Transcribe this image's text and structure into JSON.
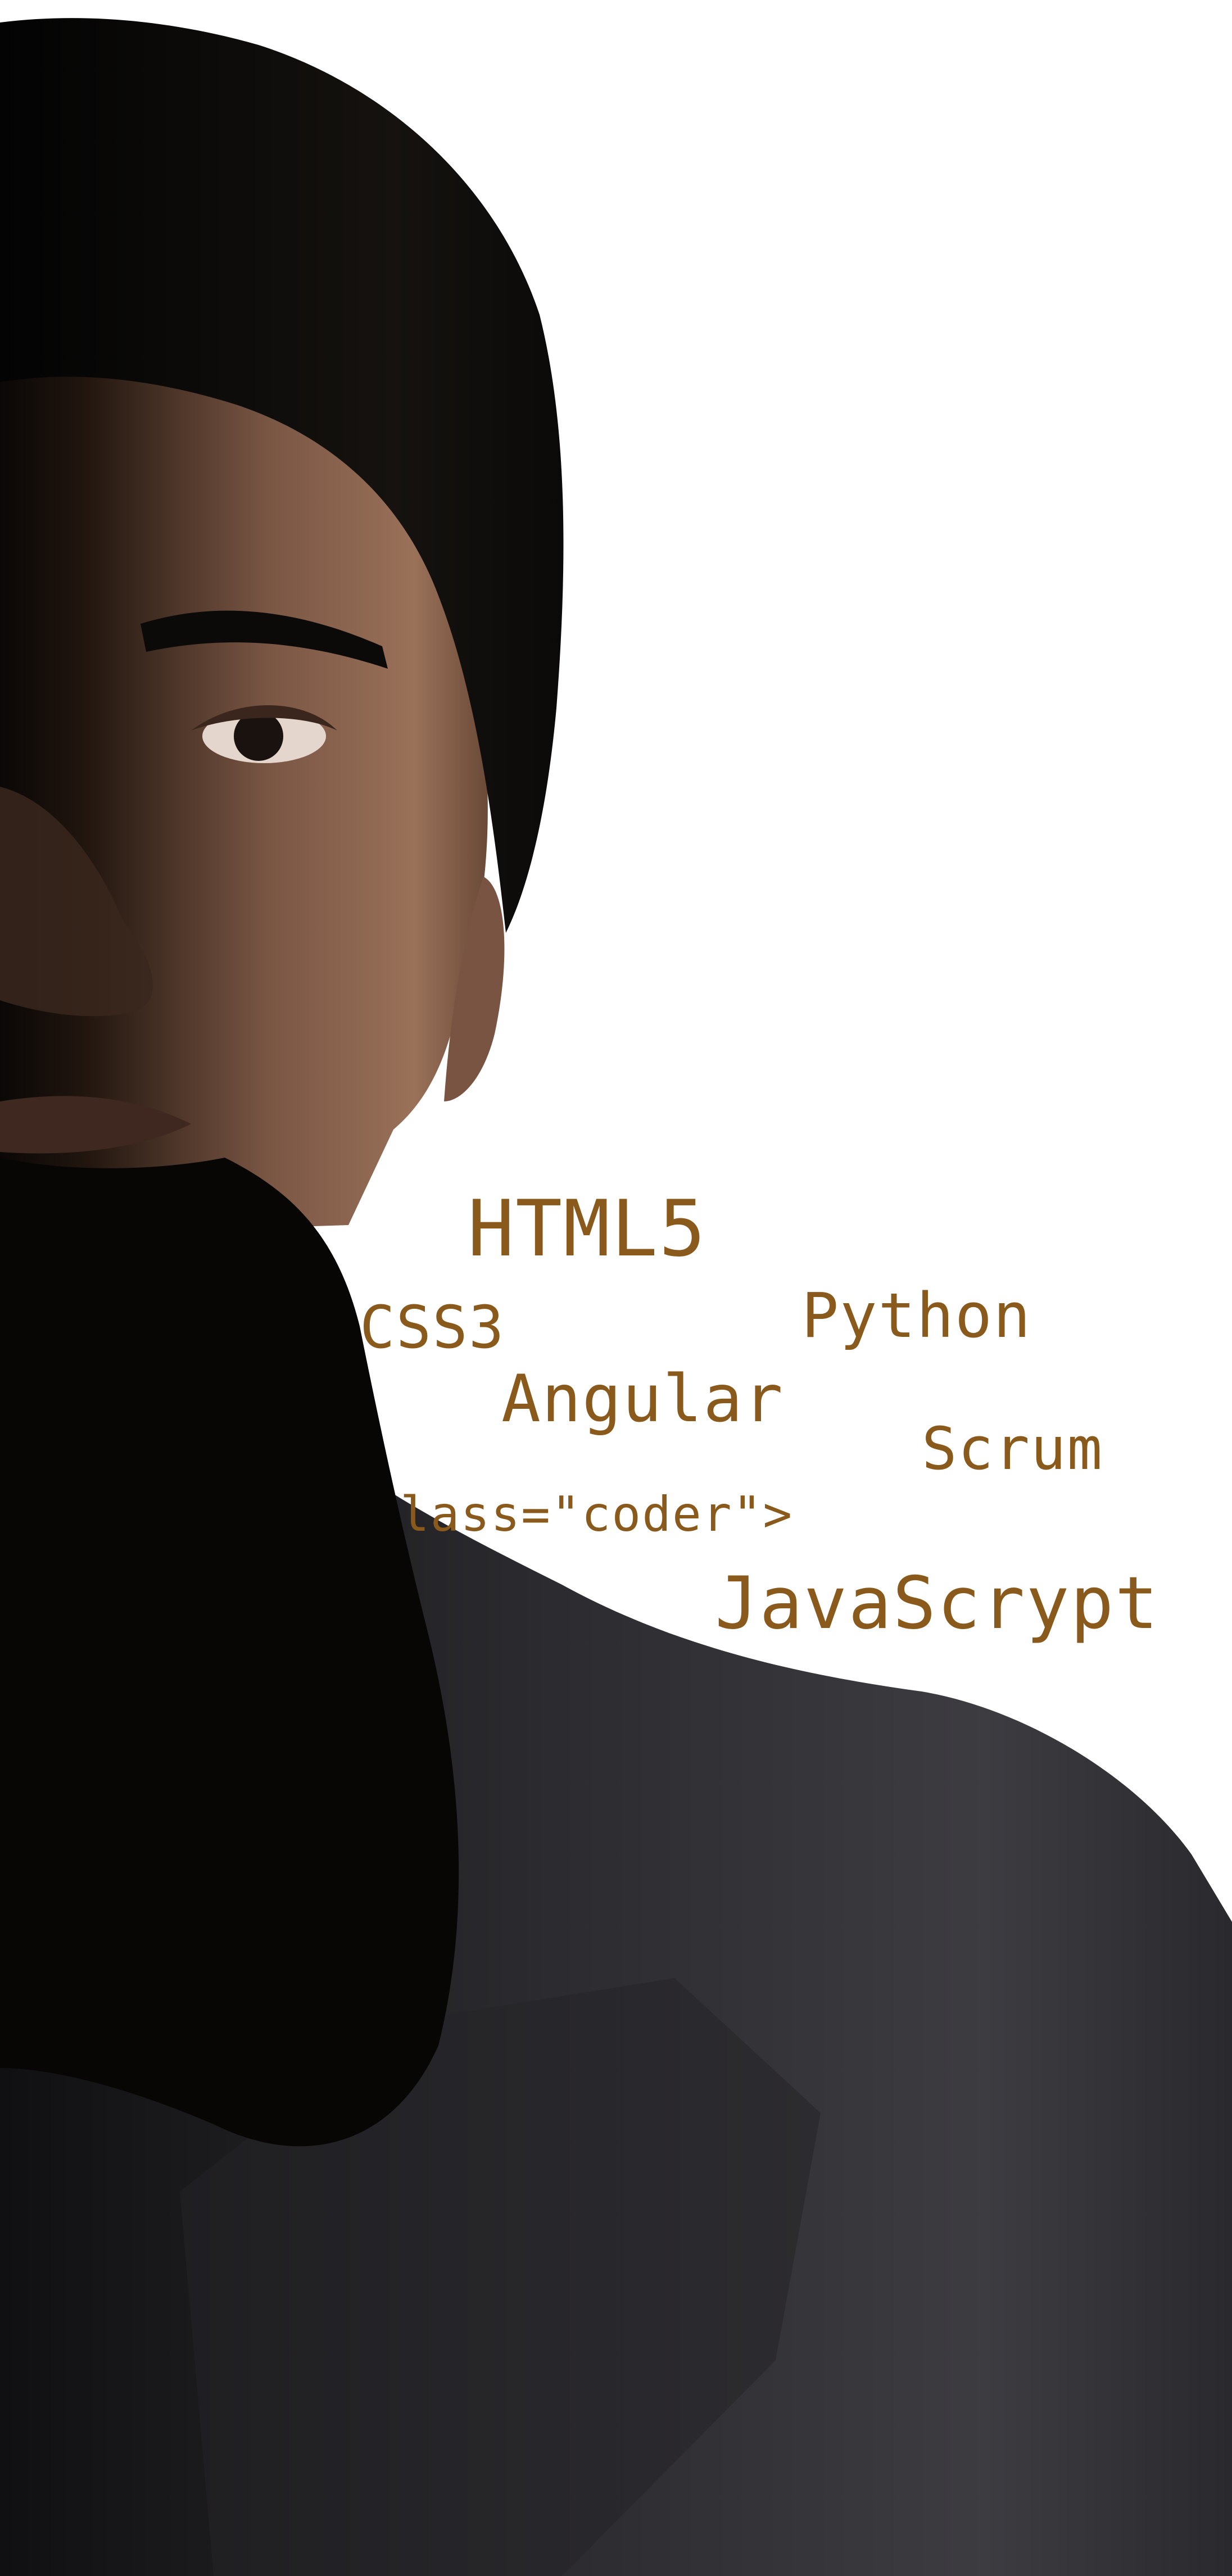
{
  "palette": {
    "background": "#ffffff",
    "text_accent": "#8a5a1c",
    "hair": "#0d0c0b",
    "skin_light": "#8f6a54",
    "skin_dark": "#2a1c15",
    "beard": "#070605",
    "shirt": "#3b3a3d"
  },
  "keywords": {
    "html5": "HTML5",
    "css3": "CSS3",
    "python": "Python",
    "angular": "Angular",
    "scrum": "Scrum",
    "coder": "lass=\"coder\">",
    "javascript": "JavaScrypt"
  }
}
